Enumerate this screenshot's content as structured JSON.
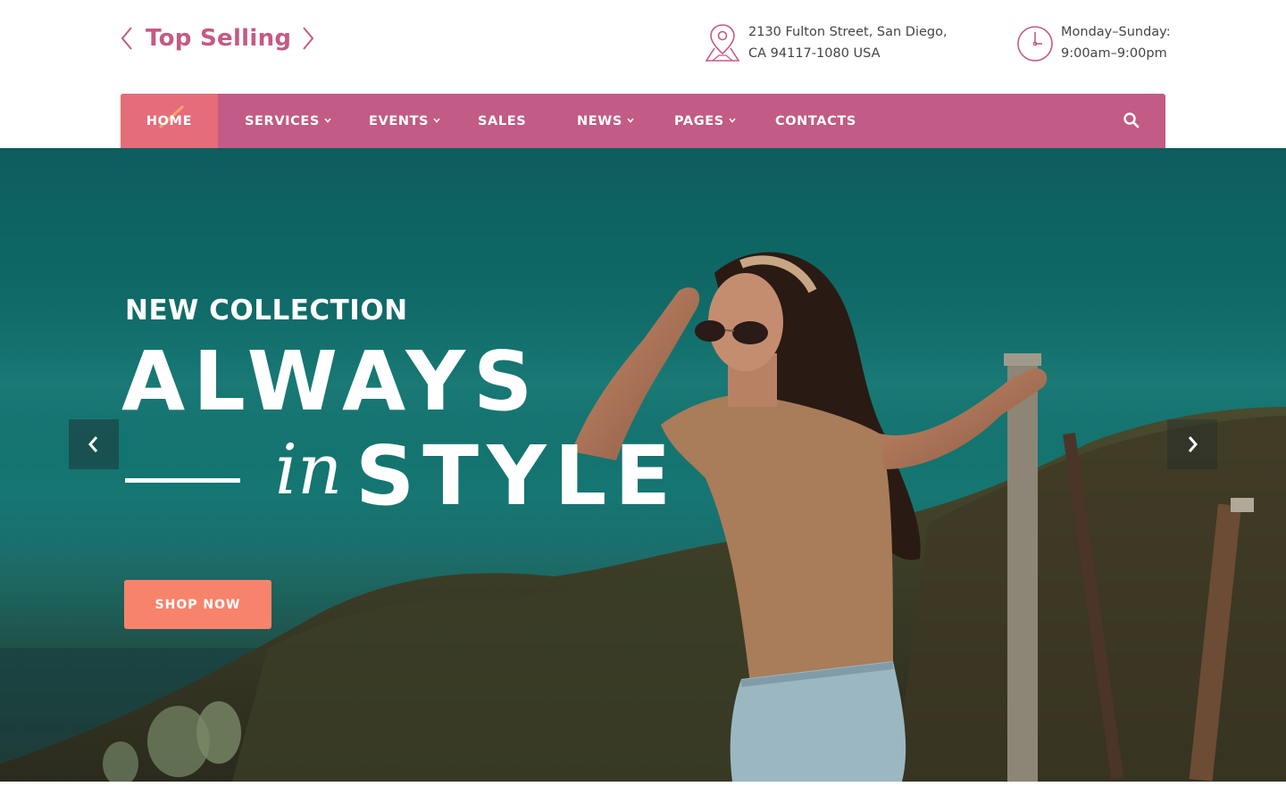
{
  "header": {
    "logo_text": "Top Selling",
    "address": {
      "icon": "map-pin-icon",
      "line1": "2130 Fulton Street, San Diego,",
      "line2": "CA 94117-1080 USA"
    },
    "hours": {
      "icon": "clock-icon",
      "line1": "Monday–Sunday:",
      "line2": "9:00am–9:00pm"
    }
  },
  "nav": {
    "items": [
      {
        "label": "HOME",
        "active": true,
        "has_dropdown": false
      },
      {
        "label": "SERVICES",
        "active": false,
        "has_dropdown": true
      },
      {
        "label": "EVENTS",
        "active": false,
        "has_dropdown": true
      },
      {
        "label": "SALES",
        "active": false,
        "has_dropdown": false
      },
      {
        "label": "NEWS",
        "active": false,
        "has_dropdown": true
      },
      {
        "label": "PAGES",
        "active": false,
        "has_dropdown": true
      },
      {
        "label": "CONTACTS",
        "active": false,
        "has_dropdown": false
      }
    ],
    "search_icon": "search-icon"
  },
  "hero": {
    "kicker": "NEW COLLECTION",
    "title_line1": "ALWAYS",
    "title_in": "in",
    "title_line2": "STYLE",
    "button_label": "SHOP NOW",
    "prev_icon": "chevron-left-icon",
    "next_icon": "chevron-right-icon"
  },
  "colors": {
    "brand": "#c25b85",
    "active_nav": "#e56c7a",
    "button": "#f7836a",
    "hero_bg": "#10706c"
  }
}
